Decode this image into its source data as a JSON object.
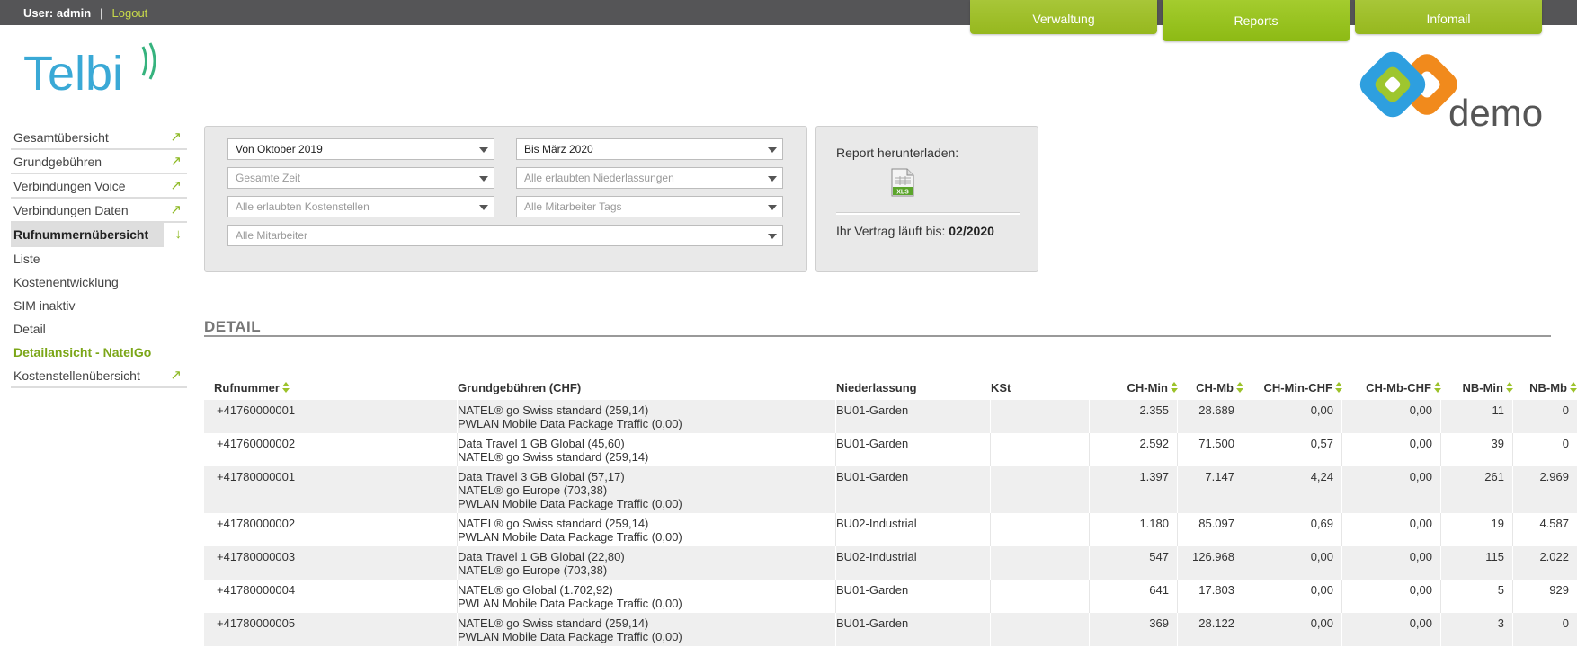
{
  "topbar": {
    "user_label": "User: admin",
    "separator": "|",
    "logout": "Logout",
    "tabs": [
      {
        "label": "Verwaltung",
        "active": false
      },
      {
        "label": "Reports",
        "active": true
      },
      {
        "label": "Infomail",
        "active": false
      }
    ]
  },
  "logos": {
    "telbi": "Telbi",
    "demo": "demo"
  },
  "sidebar": {
    "items": [
      {
        "label": "Gesamtübersicht",
        "icon": "arrow-up-right-icon"
      },
      {
        "label": "Grundgebühren",
        "icon": "arrow-up-right-icon"
      },
      {
        "label": "Verbindungen Voice",
        "icon": "arrow-up-right-icon"
      },
      {
        "label": "Verbindungen Daten",
        "icon": "arrow-up-right-icon"
      },
      {
        "label": "Rufnummernübersicht",
        "icon": "arrow-down-icon",
        "active": true
      }
    ],
    "sub_items": [
      "Liste",
      "Kostenentwicklung",
      "SIM inaktiv",
      "Detail"
    ],
    "highlight_item": "Detailansicht - NatelGo",
    "last_item": {
      "label": "Kostenstellenübersicht",
      "icon": "arrow-up-right-icon"
    },
    "arrow_up_right": "↗",
    "arrow_down": "↓"
  },
  "filters": {
    "from": "Von Oktober 2019",
    "to": "Bis März 2020",
    "period": "Gesamte Zeit",
    "branches": "Alle erlaubten Niederlassungen",
    "cost_centers": "Alle erlaubten Kostenstellen",
    "employee_tags": "Alle Mitarbeiter Tags",
    "employees": "Alle Mitarbeiter"
  },
  "report": {
    "download_label": "Report herunterladen:",
    "xls_label": "XLS",
    "contract_label": "Ihr Vertrag läuft bis:",
    "contract_value": "02/2020"
  },
  "section_title": "DETAIL",
  "table": {
    "headers": {
      "rufnummer": "Rufnummer",
      "grund": "Grundgebühren (CHF)",
      "nl": "Niederlassung",
      "kst": "KSt",
      "chmin": "CH-Min",
      "chmb": "CH-Mb",
      "chminchf": "CH-Min-CHF",
      "chmbchf": "CH-Mb-CHF",
      "nbmin": "NB-Min",
      "nbmb": "NB-Mb"
    },
    "rows": [
      {
        "num": "+41760000001",
        "plans": [
          "NATEL® go Swiss standard (259,14)",
          "PWLAN Mobile Data Package Traffic (0,00)"
        ],
        "nl": "BU01-Garden",
        "kst": "",
        "chmin": "2.355",
        "chmb": "28.689",
        "chminchf": "0,00",
        "chmbchf": "0,00",
        "nbmin": "11",
        "nbmb": "0"
      },
      {
        "num": "+41760000002",
        "plans": [
          "Data Travel 1 GB Global (45,60)",
          "NATEL® go Swiss standard (259,14)"
        ],
        "nl": "BU01-Garden",
        "kst": "",
        "chmin": "2.592",
        "chmb": "71.500",
        "chminchf": "0,57",
        "chmbchf": "0,00",
        "nbmin": "39",
        "nbmb": "0"
      },
      {
        "num": "+41780000001",
        "plans": [
          "Data Travel 3 GB Global (57,17)",
          "NATEL® go Europe (703,38)",
          "PWLAN Mobile Data Package Traffic (0,00)"
        ],
        "nl": "BU01-Garden",
        "kst": "",
        "chmin": "1.397",
        "chmb": "7.147",
        "chminchf": "4,24",
        "chmbchf": "0,00",
        "nbmin": "261",
        "nbmb": "2.969"
      },
      {
        "num": "+41780000002",
        "plans": [
          "NATEL® go Swiss standard (259,14)",
          "PWLAN Mobile Data Package Traffic (0,00)"
        ],
        "nl": "BU02-Industrial",
        "kst": "",
        "chmin": "1.180",
        "chmb": "85.097",
        "chminchf": "0,69",
        "chmbchf": "0,00",
        "nbmin": "19",
        "nbmb": "4.587"
      },
      {
        "num": "+41780000003",
        "plans": [
          "Data Travel 1 GB Global (22,80)",
          "NATEL® go Europe (703,38)"
        ],
        "nl": "BU02-Industrial",
        "kst": "",
        "chmin": "547",
        "chmb": "126.968",
        "chminchf": "0,00",
        "chmbchf": "0,00",
        "nbmin": "115",
        "nbmb": "2.022"
      },
      {
        "num": "+41780000004",
        "plans": [
          "NATEL® go Global (1.702,92)",
          "PWLAN Mobile Data Package Traffic (0,00)"
        ],
        "nl": "BU01-Garden",
        "kst": "",
        "chmin": "641",
        "chmb": "17.803",
        "chminchf": "0,00",
        "chmbchf": "0,00",
        "nbmin": "5",
        "nbmb": "929"
      },
      {
        "num": "+41780000005",
        "plans": [
          "NATEL® go Swiss standard (259,14)",
          "PWLAN Mobile Data Package Traffic (0,00)"
        ],
        "nl": "BU01-Garden",
        "kst": "",
        "chmin": "369",
        "chmb": "28.122",
        "chminchf": "0,00",
        "chmbchf": "0,00",
        "nbmin": "3",
        "nbmb": "0"
      }
    ]
  }
}
